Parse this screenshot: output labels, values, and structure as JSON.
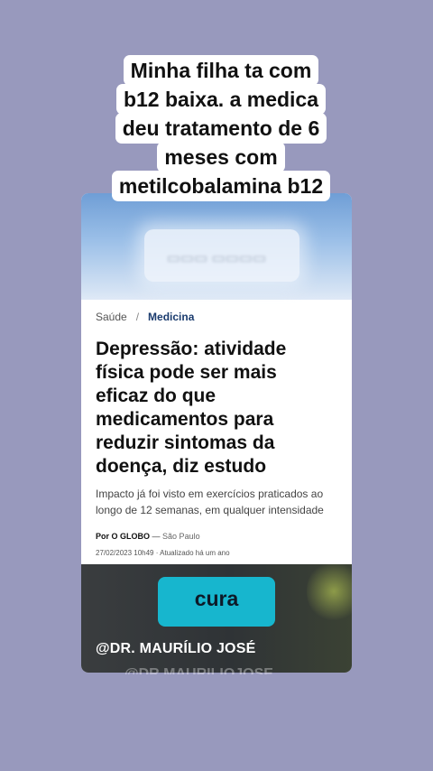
{
  "caption": {
    "lines": [
      "Minha filha ta com",
      "b12 baixa. a medica",
      "deu tratamento de 6",
      "meses com",
      "metilcobalamina b12"
    ]
  },
  "article": {
    "breadcrumb": {
      "section": "Saúde",
      "separator": "/",
      "current": "Medicina"
    },
    "headline": "Depressão: atividade física pode ser mais eficaz do que medicamentos para reduzir sintomas da doença, diz estudo",
    "subhead": "Impacto já foi visto em exercícios praticados ao longo de 12 semanas, em qualquer intensidade",
    "byline": {
      "author": "Por O GLOBO",
      "dash": "—",
      "city": "São Paulo"
    },
    "dateline": "27/02/2023 10h49 · Atualizado há um ano"
  },
  "sticker": {
    "label": "cura",
    "color": "#17b6ce"
  },
  "watermark": {
    "handle": "@DR. MAURÍLIO JOSÉ",
    "echo": "@DR.MAURILIOJOSE"
  },
  "colors": {
    "background": "#9899bd",
    "link_blue": "#1a3b6e"
  }
}
